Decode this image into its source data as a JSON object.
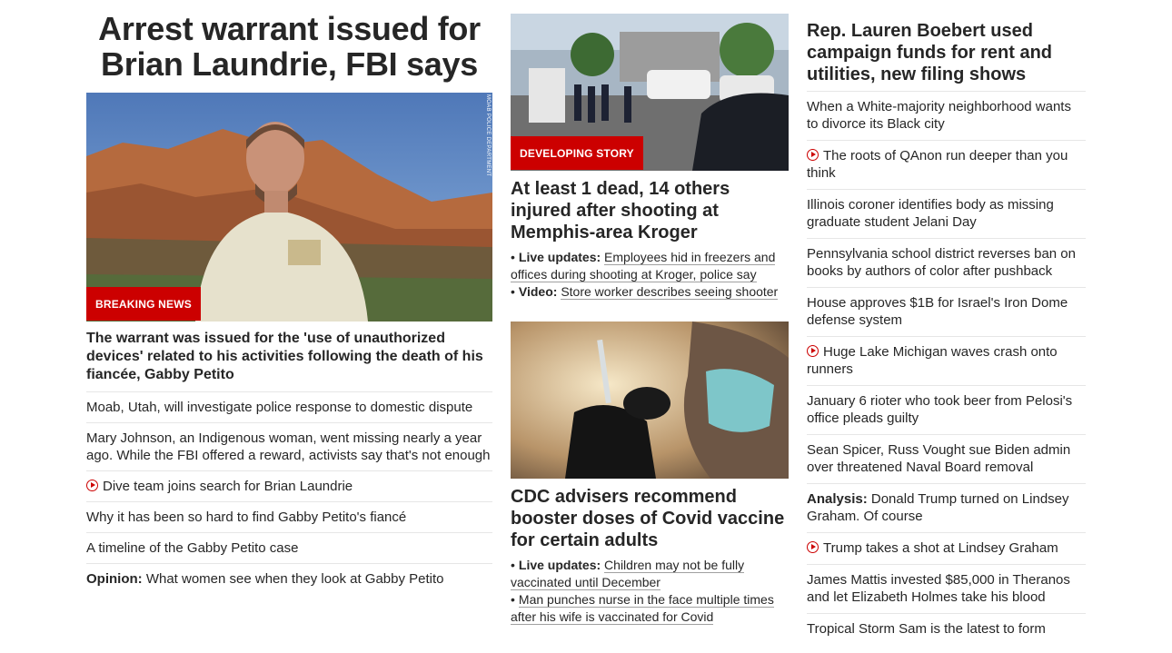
{
  "col1": {
    "headline": "Arrest warrant issued for Brian Laundrie, FBI says",
    "image_badge": "BREAKING NEWS",
    "image_credit": "MOAB POLICE DEPARTMENT",
    "lead_sub": "The warrant was issued for the 'use of unauthorized devices' related to his activities following the death of his fiancée, Gabby Petito",
    "links": [
      {
        "text": "Moab, Utah, will investigate police response to domestic dispute"
      },
      {
        "text": "Mary Johnson, an Indigenous woman, went missing nearly a year ago. While the FBI offered a reward, activists say that's not enough"
      },
      {
        "text": "Dive team joins search for Brian Laundrie",
        "video": true
      },
      {
        "text": "Why it has been so hard to find Gabby Petito's fiancé"
      },
      {
        "text": "A timeline of the Gabby Petito case"
      },
      {
        "prefix": "Opinion:",
        "text": "What women see when they look at Gabby Petito"
      }
    ]
  },
  "col2": {
    "story1": {
      "image_badge": "DEVELOPING STORY",
      "headline": "At least 1 dead, 14 others injured after shooting at Memphis-area Kroger",
      "bullets": [
        {
          "prefix": "Live updates:",
          "text": "Employees hid in freezers and offices during shooting at Kroger, police say"
        },
        {
          "prefix": "Video:",
          "text": "Store worker describes seeing shooter"
        }
      ]
    },
    "story2": {
      "headline": "CDC advisers recommend booster doses of Covid vaccine for certain adults",
      "bullets": [
        {
          "prefix": "Live updates:",
          "text": "Children may not be fully vaccinated until December"
        },
        {
          "prefix": "",
          "text": "Man punches nurse in the face multiple times after his wife is vaccinated for Covid"
        }
      ]
    }
  },
  "col3": {
    "headline": "Rep. Lauren Boebert used campaign funds for rent and utilities, new filing shows",
    "links": [
      {
        "text": "When a White-majority neighborhood wants to divorce its Black city"
      },
      {
        "text": "The roots of QAnon run deeper than you think",
        "video": true
      },
      {
        "text": "Illinois coroner identifies body as missing graduate student Jelani Day"
      },
      {
        "text": "Pennsylvania school district reverses ban on books by authors of color after pushback"
      },
      {
        "text": "House approves $1B for Israel's Iron Dome defense system"
      },
      {
        "text": "Huge Lake Michigan waves crash onto runners",
        "video": true
      },
      {
        "text": "January 6 rioter who took beer from Pelosi's office pleads guilty"
      },
      {
        "text": "Sean Spicer, Russ Vought sue Biden admin over threatened Naval Board removal"
      },
      {
        "prefix": "Analysis:",
        "text": "Donald Trump turned on Lindsey Graham. Of course"
      },
      {
        "text": "Trump takes a shot at Lindsey Graham",
        "video": true
      },
      {
        "text": "James Mattis invested $85,000 in Theranos and let Elizabeth Holmes take his blood"
      },
      {
        "text": "Tropical Storm Sam is the latest to form"
      }
    ]
  },
  "colors": {
    "accent_red": "#cc0000",
    "text": "#262626",
    "divider": "#e6e6e6"
  },
  "icons": {
    "video": "play-circle-icon"
  }
}
